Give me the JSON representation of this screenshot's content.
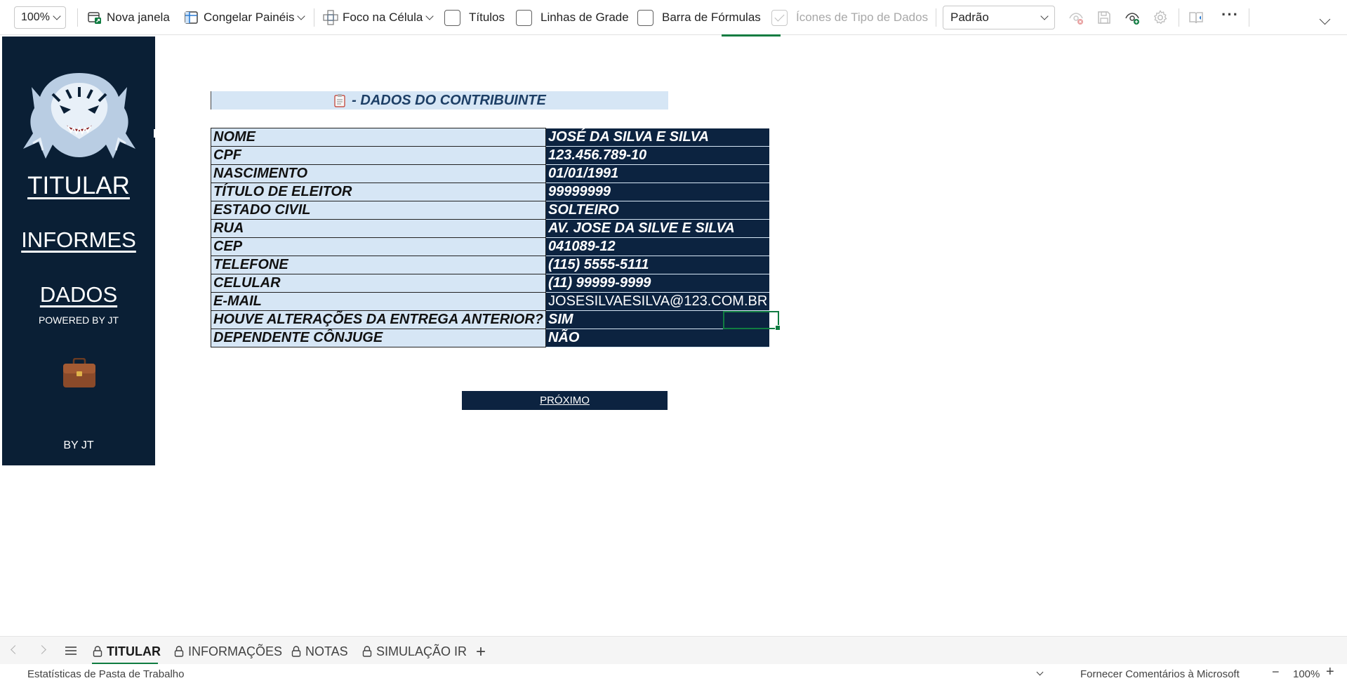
{
  "toolbar": {
    "zoom": "100%",
    "new_window": "Nova janela",
    "freeze_panes": "Congelar Painéis",
    "cell_focus": "Foco na Célula",
    "titles": "Títulos",
    "gridlines": "Linhas de Grade",
    "formula_bar": "Barra de Fórmulas",
    "data_type_icons": "Ícones de Tipo de Dados",
    "view_select": "Padrão"
  },
  "sidebar": {
    "links": [
      "TITULAR",
      "INFORMES",
      "DADOS"
    ],
    "powered": "POWERED BY JT",
    "footer": "BY JT"
  },
  "sheet": {
    "title": "- DADOS DO CONTRIBUINTE",
    "rows": [
      {
        "label": "NOME",
        "value": "JOSÉ DA SILVA E SILVA"
      },
      {
        "label": "CPF",
        "value": "123.456.789-10"
      },
      {
        "label": "NASCIMENTO",
        "value": "01/01/1991"
      },
      {
        "label": "TÍTULO DE ELEITOR",
        "value": "99999999"
      },
      {
        "label": "ESTADO CIVIL",
        "value": "SOLTEIRO"
      },
      {
        "label": "RUA",
        "value": "AV. JOSE DA SILVE E SILVA"
      },
      {
        "label": "CEP",
        "value": "041089-12"
      },
      {
        "label": "TELEFONE",
        "value": "(115) 5555-5111"
      },
      {
        "label": "CELULAR",
        "value": "(11) 99999-9999"
      },
      {
        "label": "E-MAIL",
        "value": "JOSESILVAESILVA@123.COM.BR"
      },
      {
        "label": "HOUVE ALTERAÇÕES DA ENTREGA ANTERIOR?",
        "value": "SIM"
      },
      {
        "label": "DEPENDENTE CÔNJUGE",
        "value": "NÃO"
      }
    ],
    "next_button": "PRÓXIMO"
  },
  "tabs": [
    "TITULAR",
    "INFORMAÇÕES",
    "NOTAS",
    "SIMULAÇÃO IR"
  ],
  "status": {
    "left": "Estatísticas de Pasta de Trabalho",
    "feedback": "Fornecer Comentários à Microsoft",
    "zoom": "100%"
  },
  "colors": {
    "navy": "#0c2340",
    "light_blue": "#d6e6f5",
    "excel_green": "#107c41"
  }
}
